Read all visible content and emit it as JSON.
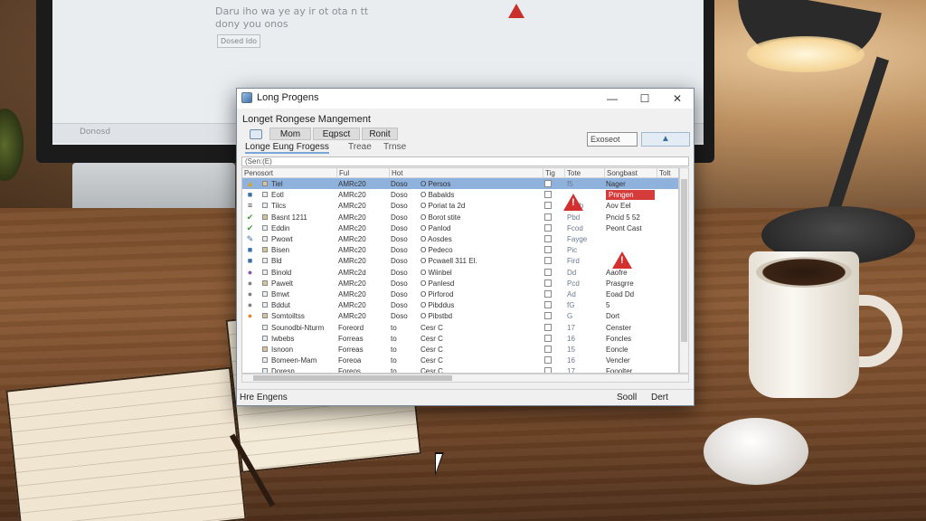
{
  "background": {
    "monitor_line1": "Daru iho wa ye ay ir ot ota n tt",
    "monitor_line2": "dony you onos",
    "monitor_button": "Dosed Ido",
    "taskbar_label": "Donosd"
  },
  "window": {
    "title": "Long Progens",
    "heading": "Longet Rongese Mangement",
    "controls": {
      "minimize": "—",
      "maximize": "☐",
      "close": "✕"
    },
    "menu": [
      "Mom",
      "Eqpsct",
      "Ronit"
    ],
    "tabs": [
      "Longe Eung Frogess",
      "Treae",
      "Trnse"
    ],
    "export_label": "Exoseot",
    "up_label": "▲",
    "search_value": "(Sen:(E)",
    "columns": [
      "Penosort",
      "Ful",
      "Hot",
      "Tig",
      "Tote",
      "Songbast",
      "Tolt"
    ],
    "rows": [
      {
        "icon": "warning",
        "name": "Tiel",
        "c1": "AMRc20",
        "c2": "Doso",
        "c3": "O Persos",
        "tig": "",
        "tote": "f5",
        "status": "Nager",
        "selected": true
      },
      {
        "icon": "image",
        "name": "Eotl",
        "c1": "AMRc20",
        "c2": "Doso",
        "c3": "O Babalds",
        "tig": "",
        "tote": "",
        "status": "Pnngen",
        "status_bad": true
      },
      {
        "icon": "text",
        "name": "Tilcs",
        "c1": "AMRc20",
        "c2": "Doso",
        "c3": "O Poriat ta 2d",
        "tig": "",
        "tote": "Ciblb",
        "status": "Aov Eel"
      },
      {
        "icon": "check",
        "name": "Basnt 1211",
        "c1": "AMRc20",
        "c2": "Doso",
        "c3": "O Borot stite",
        "tig": "",
        "tote": "Pbd",
        "status": "Pncid 5 52"
      },
      {
        "icon": "check",
        "name": "Eddin",
        "c1": "AMRc20",
        "c2": "Doso",
        "c3": "O Panlod",
        "tig": "",
        "tote": "Fcod",
        "status": "Peont Cast"
      },
      {
        "icon": "edit",
        "name": "Pwowt",
        "c1": "AMRc20",
        "c2": "Doso",
        "c3": "O Aosdes",
        "tig": "",
        "tote": "Fayge",
        "status": ""
      },
      {
        "icon": "image",
        "name": "Bisen",
        "c1": "AMRc20",
        "c2": "Doso",
        "c3": "O Pedeco",
        "tig": "",
        "tote": "Pic",
        "status": ""
      },
      {
        "icon": "image",
        "name": "Bld",
        "c1": "AMRc20",
        "c2": "Doso",
        "c3": "O Pcwaell 311 El.",
        "tig": "",
        "tote": "Fird",
        "status": ""
      },
      {
        "icon": "circle-purple",
        "name": "Binold",
        "c1": "AMRc2d",
        "c2": "Doso",
        "c3": "O Wiinbel",
        "tig": "",
        "tote": "Dd",
        "status": "Aaofre"
      },
      {
        "icon": "circle-gray",
        "name": "Pawelt",
        "c1": "AMRc20",
        "c2": "Doso",
        "c3": "O Panlesd",
        "tig": "",
        "tote": "Pcd",
        "status": "Prasgrre"
      },
      {
        "icon": "circle-gray",
        "name": "Bmwt",
        "c1": "AMRc20",
        "c2": "Doso",
        "c3": "O Pirforod",
        "tig": "",
        "tote": "Ad",
        "status": "Eoad Dd"
      },
      {
        "icon": "circle-gray",
        "name": "Bddut",
        "c1": "AMRc20",
        "c2": "Doso",
        "c3": "O Pibddus",
        "tig": "",
        "tote": "fG",
        "status": "5"
      },
      {
        "icon": "circle-orange",
        "name": "Somtoiltss",
        "c1": "AMRc20",
        "c2": "Doso",
        "c3": "O Pibstbd",
        "tig": "",
        "tote": "G",
        "status": "Dort"
      },
      {
        "icon": "none",
        "name": "Sounodbi-Nturm",
        "c1": "Foreord",
        "c2": "to",
        "c3": "Cesr C",
        "tig": "",
        "tote": "17",
        "status": "Censter"
      },
      {
        "icon": "none",
        "name": "Iwbebs",
        "c1": "Forreas",
        "c2": "to",
        "c3": "Cesr C",
        "tig": "",
        "tote": "16",
        "status": "Foncles"
      },
      {
        "icon": "none",
        "name": "Isnoon",
        "c1": "Forreas",
        "c2": "to",
        "c3": "Cesr C",
        "tig": "",
        "tote": "15",
        "status": "Eoncle"
      },
      {
        "icon": "none",
        "name": "Bomeen-Mam",
        "c1": "Foreoa",
        "c2": "to",
        "c3": "Cesr C",
        "tig": "",
        "tote": "16",
        "status": "Vencler"
      },
      {
        "icon": "none",
        "name": "Doresn",
        "c1": "Foreos",
        "c2": "to",
        "c3": "Cesr C",
        "tig": "",
        "tote": "17",
        "status": "Fooolter"
      }
    ],
    "status_left": "Hre Engens",
    "status_right_1": "Sooll",
    "status_right_2": "Dert"
  }
}
